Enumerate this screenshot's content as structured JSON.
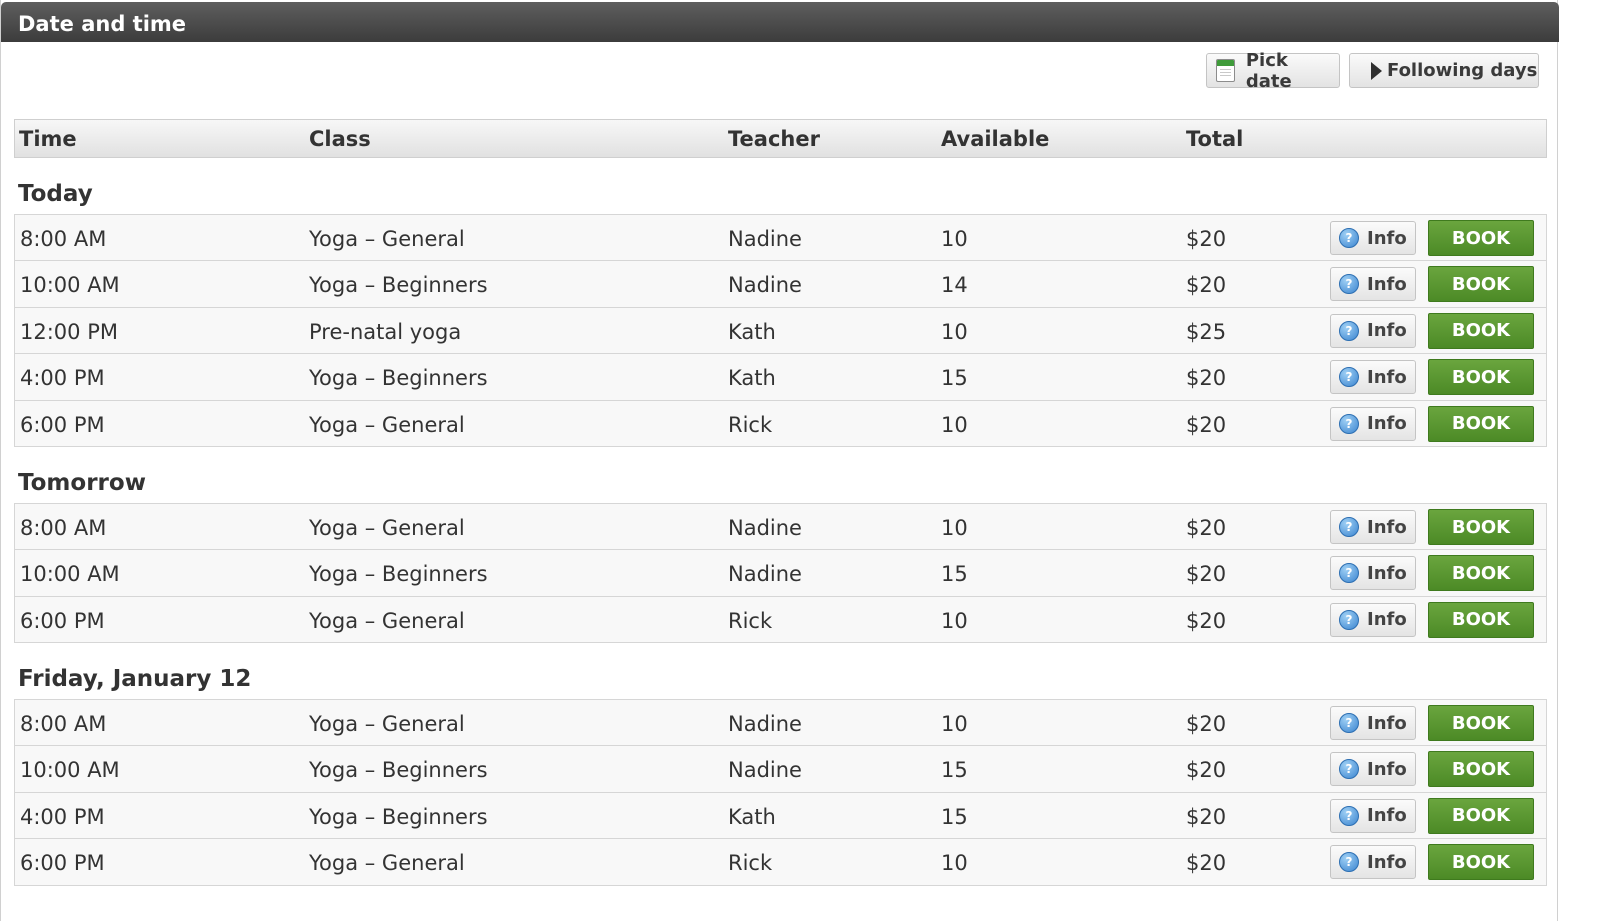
{
  "title": "Date and time",
  "toolbar": {
    "pick_date": "Pick date",
    "following_days": "Following days"
  },
  "columns": {
    "time": "Time",
    "class": "Class",
    "teacher": "Teacher",
    "available": "Available",
    "total": "Total"
  },
  "buttons": {
    "info": "Info",
    "book": "BOOK"
  },
  "groups": [
    {
      "label": "Today",
      "rows": [
        {
          "time": "8:00 AM",
          "class": "Yoga – General",
          "teacher": "Nadine",
          "available": "10",
          "total": "$20"
        },
        {
          "time": "10:00 AM",
          "class": "Yoga – Beginners",
          "teacher": "Nadine",
          "available": "14",
          "total": "$20"
        },
        {
          "time": "12:00 PM",
          "class": "Pre-natal yoga",
          "teacher": "Kath",
          "available": "10",
          "total": "$25"
        },
        {
          "time": "4:00 PM",
          "class": "Yoga – Beginners",
          "teacher": "Kath",
          "available": "15",
          "total": "$20"
        },
        {
          "time": "6:00 PM",
          "class": "Yoga – General",
          "teacher": "Rick",
          "available": "10",
          "total": "$20"
        }
      ]
    },
    {
      "label": "Tomorrow",
      "rows": [
        {
          "time": "8:00 AM",
          "class": "Yoga – General",
          "teacher": "Nadine",
          "available": "10",
          "total": "$20"
        },
        {
          "time": "10:00 AM",
          "class": "Yoga – Beginners",
          "teacher": "Nadine",
          "available": "15",
          "total": "$20"
        },
        {
          "time": "6:00 PM",
          "class": "Yoga – General",
          "teacher": "Rick",
          "available": "10",
          "total": "$20"
        }
      ]
    },
    {
      "label": "Friday, January 12",
      "rows": [
        {
          "time": "8:00 AM",
          "class": "Yoga – General",
          "teacher": "Nadine",
          "available": "10",
          "total": "$20"
        },
        {
          "time": "10:00 AM",
          "class": "Yoga – Beginners",
          "teacher": "Nadine",
          "available": "15",
          "total": "$20"
        },
        {
          "time": "4:00 PM",
          "class": "Yoga – Beginners",
          "teacher": "Kath",
          "available": "15",
          "total": "$20"
        },
        {
          "time": "6:00 PM",
          "class": "Yoga – General",
          "teacher": "Rick",
          "available": "10",
          "total": "$20"
        }
      ]
    }
  ]
}
